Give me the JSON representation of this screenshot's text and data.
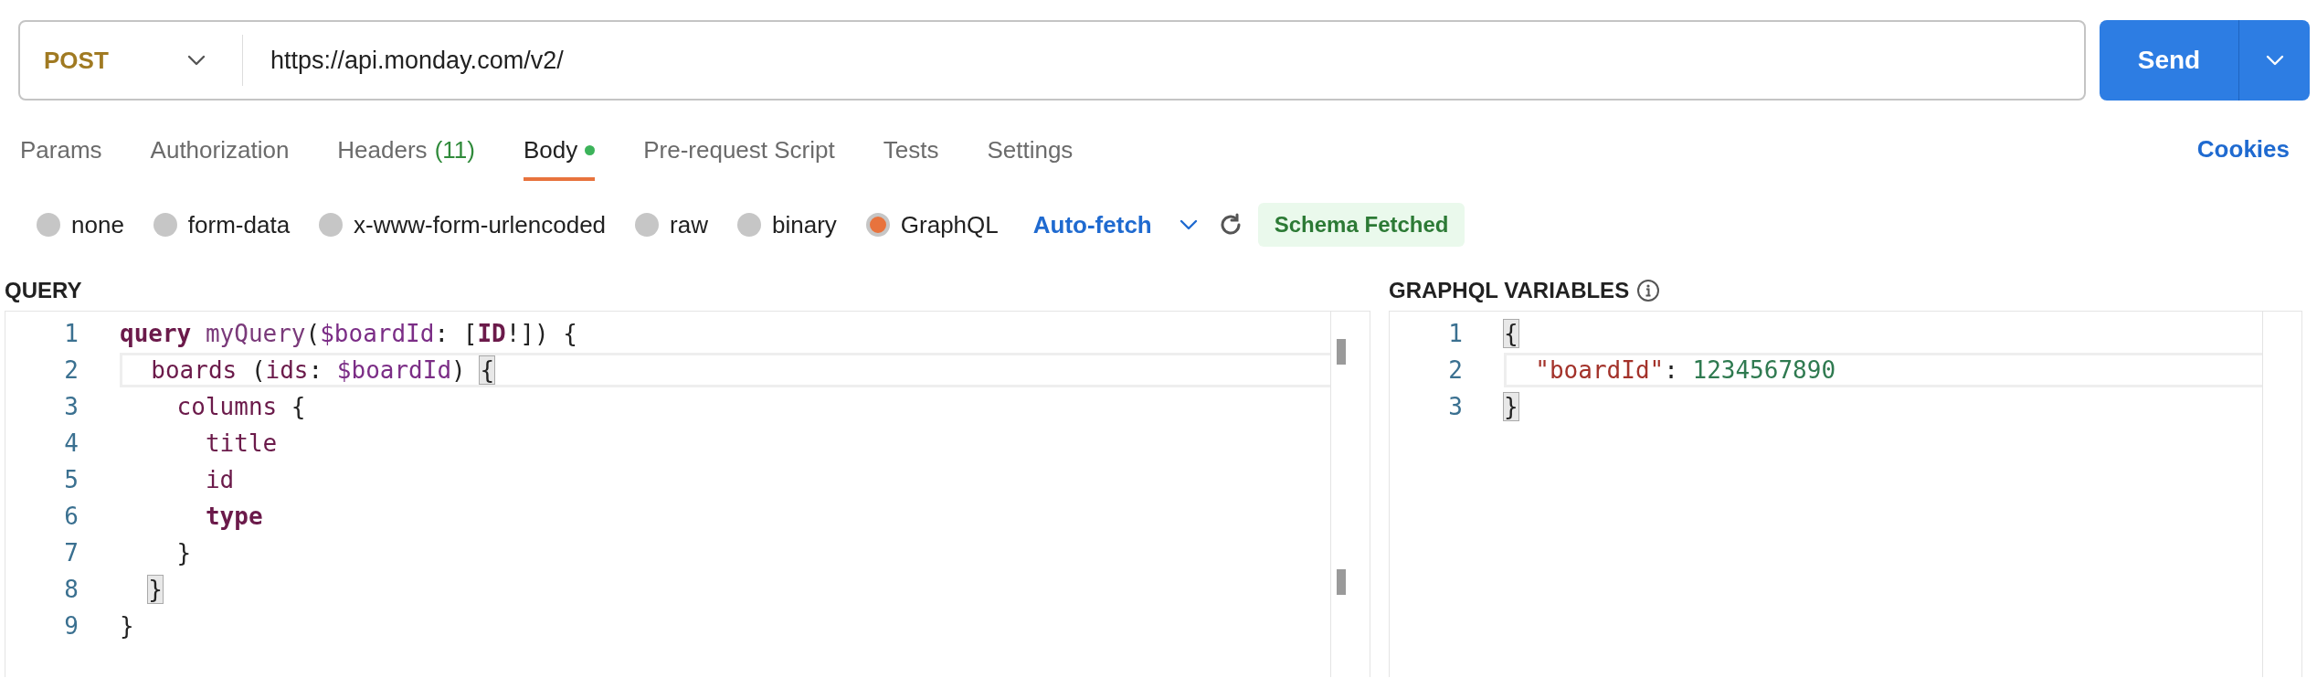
{
  "request": {
    "method": "POST",
    "url": "https://api.monday.com/v2/"
  },
  "send_button": {
    "label": "Send"
  },
  "tabs": [
    {
      "label": "Params",
      "selected": false
    },
    {
      "label": "Authorization",
      "selected": false
    },
    {
      "label": "Headers",
      "count": "(11)",
      "selected": false
    },
    {
      "label": "Body",
      "selected": true,
      "has_content": true
    },
    {
      "label": "Pre-request Script",
      "selected": false
    },
    {
      "label": "Tests",
      "selected": false
    },
    {
      "label": "Settings",
      "selected": false
    }
  ],
  "cookies_link": "Cookies",
  "body_types": [
    {
      "label": "none",
      "selected": false
    },
    {
      "label": "form-data",
      "selected": false
    },
    {
      "label": "x-www-form-urlencoded",
      "selected": false
    },
    {
      "label": "raw",
      "selected": false
    },
    {
      "label": "binary",
      "selected": false
    },
    {
      "label": "GraphQL",
      "selected": true
    }
  ],
  "auto_fetch": {
    "label": "Auto-fetch"
  },
  "schema_status": "Schema Fetched",
  "query_editor": {
    "label": "QUERY",
    "lines": [
      {
        "number": "1",
        "active": false,
        "tokens": [
          {
            "kind": "keyword",
            "text": "query"
          },
          {
            "kind": "name",
            "text": " myQuery"
          },
          {
            "kind": "punct",
            "text": "("
          },
          {
            "kind": "variable",
            "text": "$boardId"
          },
          {
            "kind": "punct",
            "text": ": ["
          },
          {
            "kind": "type",
            "text": "ID"
          },
          {
            "kind": "punct",
            "text": "!]) {"
          }
        ]
      },
      {
        "number": "2",
        "active": true,
        "tokens": [
          {
            "kind": "field",
            "text": "  boards"
          },
          {
            "kind": "punct",
            "text": " ("
          },
          {
            "kind": "field",
            "text": "ids"
          },
          {
            "kind": "punct",
            "text": ": "
          },
          {
            "kind": "variable",
            "text": "$boardId"
          },
          {
            "kind": "punct",
            "text": ") "
          },
          {
            "kind": "matched",
            "text": "{"
          }
        ]
      },
      {
        "number": "3",
        "active": false,
        "tokens": [
          {
            "kind": "field",
            "text": "    columns"
          },
          {
            "kind": "punct",
            "text": " {"
          }
        ]
      },
      {
        "number": "4",
        "active": false,
        "tokens": [
          {
            "kind": "field",
            "text": "      title"
          }
        ]
      },
      {
        "number": "5",
        "active": false,
        "tokens": [
          {
            "kind": "field",
            "text": "      id"
          }
        ]
      },
      {
        "number": "6",
        "active": false,
        "tokens": [
          {
            "kind": "keyword",
            "text": "      type"
          }
        ]
      },
      {
        "number": "7",
        "active": false,
        "tokens": [
          {
            "kind": "punct",
            "text": "    }"
          }
        ]
      },
      {
        "number": "8",
        "active": false,
        "tokens": [
          {
            "kind": "indented-matched",
            "text": "  }"
          }
        ]
      },
      {
        "number": "9",
        "active": false,
        "tokens": [
          {
            "kind": "punct",
            "text": "}"
          }
        ]
      }
    ]
  },
  "variables_editor": {
    "label": "GRAPHQL VARIABLES",
    "lines": [
      {
        "number": "1",
        "active": false,
        "tokens": [
          {
            "kind": "matched",
            "text": "{"
          }
        ]
      },
      {
        "number": "2",
        "active": true,
        "tokens": [
          {
            "kind": "string",
            "text": "  \"boardId\""
          },
          {
            "kind": "punct",
            "text": ": "
          },
          {
            "kind": "number",
            "text": "1234567890"
          }
        ]
      },
      {
        "number": "3",
        "active": false,
        "tokens": [
          {
            "kind": "matched",
            "text": "}"
          }
        ]
      }
    ]
  }
}
